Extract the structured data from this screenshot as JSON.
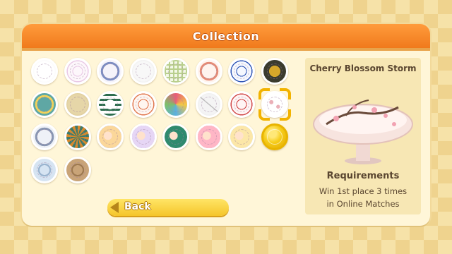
{
  "screen": {
    "title": "Collection"
  },
  "plates": [
    {
      "id": "plate-1",
      "colors": [
        "#ffffff",
        "#f0eeee"
      ],
      "style": "plain"
    },
    {
      "id": "plate-2",
      "colors": [
        "#fdf7fb",
        "#e9c9e6"
      ],
      "style": "floral"
    },
    {
      "id": "plate-3",
      "colors": [
        "#f5f3fa",
        "#7d8ec2"
      ],
      "style": "ring"
    },
    {
      "id": "plate-4",
      "colors": [
        "#f8f8f8",
        "#dcdcdc"
      ],
      "style": "plain"
    },
    {
      "id": "plate-5",
      "colors": [
        "#f3f8e6",
        "#b9cf8d"
      ],
      "style": "checker"
    },
    {
      "id": "plate-6",
      "colors": [
        "#fff4ee",
        "#e58c77"
      ],
      "style": "ring"
    },
    {
      "id": "plate-7",
      "colors": [
        "#f5f8ff",
        "#2f55b5"
      ],
      "style": "floral"
    },
    {
      "id": "plate-8",
      "colors": [
        "#3b3b2e",
        "#d7a72a"
      ],
      "style": "dark"
    },
    {
      "id": "plate-9",
      "colors": [
        "#5fa7a4",
        "#f2d35a"
      ],
      "style": "ring"
    },
    {
      "id": "plate-10",
      "colors": [
        "#e6d6a8",
        "#cdb77c"
      ],
      "style": "plain"
    },
    {
      "id": "plate-11",
      "colors": [
        "#ffffff",
        "#2e6e4f"
      ],
      "style": "stripe"
    },
    {
      "id": "plate-12",
      "colors": [
        "#fff6f0",
        "#e07850"
      ],
      "style": "floral"
    },
    {
      "id": "plate-13",
      "colors": [
        "#ffffff",
        "#e85c7a"
      ],
      "style": "multi"
    },
    {
      "id": "plate-14",
      "colors": [
        "#f4f4f4",
        "#bcbcbc"
      ],
      "style": "crack"
    },
    {
      "id": "plate-15",
      "colors": [
        "#fff4f4",
        "#d04848"
      ],
      "style": "floral"
    },
    {
      "id": "plate-16",
      "colors": [
        "#ffffff",
        "#eab0b8"
      ],
      "style": "cherry"
    },
    {
      "id": "plate-17",
      "colors": [
        "#eef1f7",
        "#8896b2"
      ],
      "style": "ring"
    },
    {
      "id": "plate-18",
      "colors": [
        "#d88a2c",
        "#3e7a6a"
      ],
      "style": "mandala"
    },
    {
      "id": "plate-19",
      "colors": [
        "#fbd79a",
        "#6b8bd8"
      ],
      "style": "character"
    },
    {
      "id": "plate-20",
      "colors": [
        "#e6d6f5",
        "#9d6fd0"
      ],
      "style": "character"
    },
    {
      "id": "plate-21",
      "colors": [
        "#2f8a6e",
        "#f0d6c0"
      ],
      "style": "character"
    },
    {
      "id": "plate-22",
      "colors": [
        "#ffb6c6",
        "#e05070"
      ],
      "style": "character"
    },
    {
      "id": "plate-23",
      "colors": [
        "#fce7a8",
        "#9ad0e8"
      ],
      "style": "character"
    },
    {
      "id": "plate-24",
      "colors": [
        "#f6cd1a",
        "#e2a800"
      ],
      "style": "coin"
    },
    {
      "id": "plate-25",
      "colors": [
        "#d6e4f2",
        "#9ab4cf"
      ],
      "style": "sun"
    },
    {
      "id": "plate-26",
      "colors": [
        "#c9a478",
        "#9e7a52"
      ],
      "style": "sun"
    }
  ],
  "selected_plate": "plate-16",
  "detail": {
    "item_name": "Cherry Blossom Storm",
    "requirements_title": "Requirements",
    "requirements_line1": "Win 1st place 3 times",
    "requirements_line2": "in Online Matches"
  },
  "footer": {
    "back_label": "Back"
  },
  "colors": {
    "accent_orange": "#f07a1c",
    "button_yellow": "#f5c52a",
    "panel_bg": "#fff6d8",
    "detail_bg": "#f7e7b4",
    "text_brown": "#5a4630"
  }
}
